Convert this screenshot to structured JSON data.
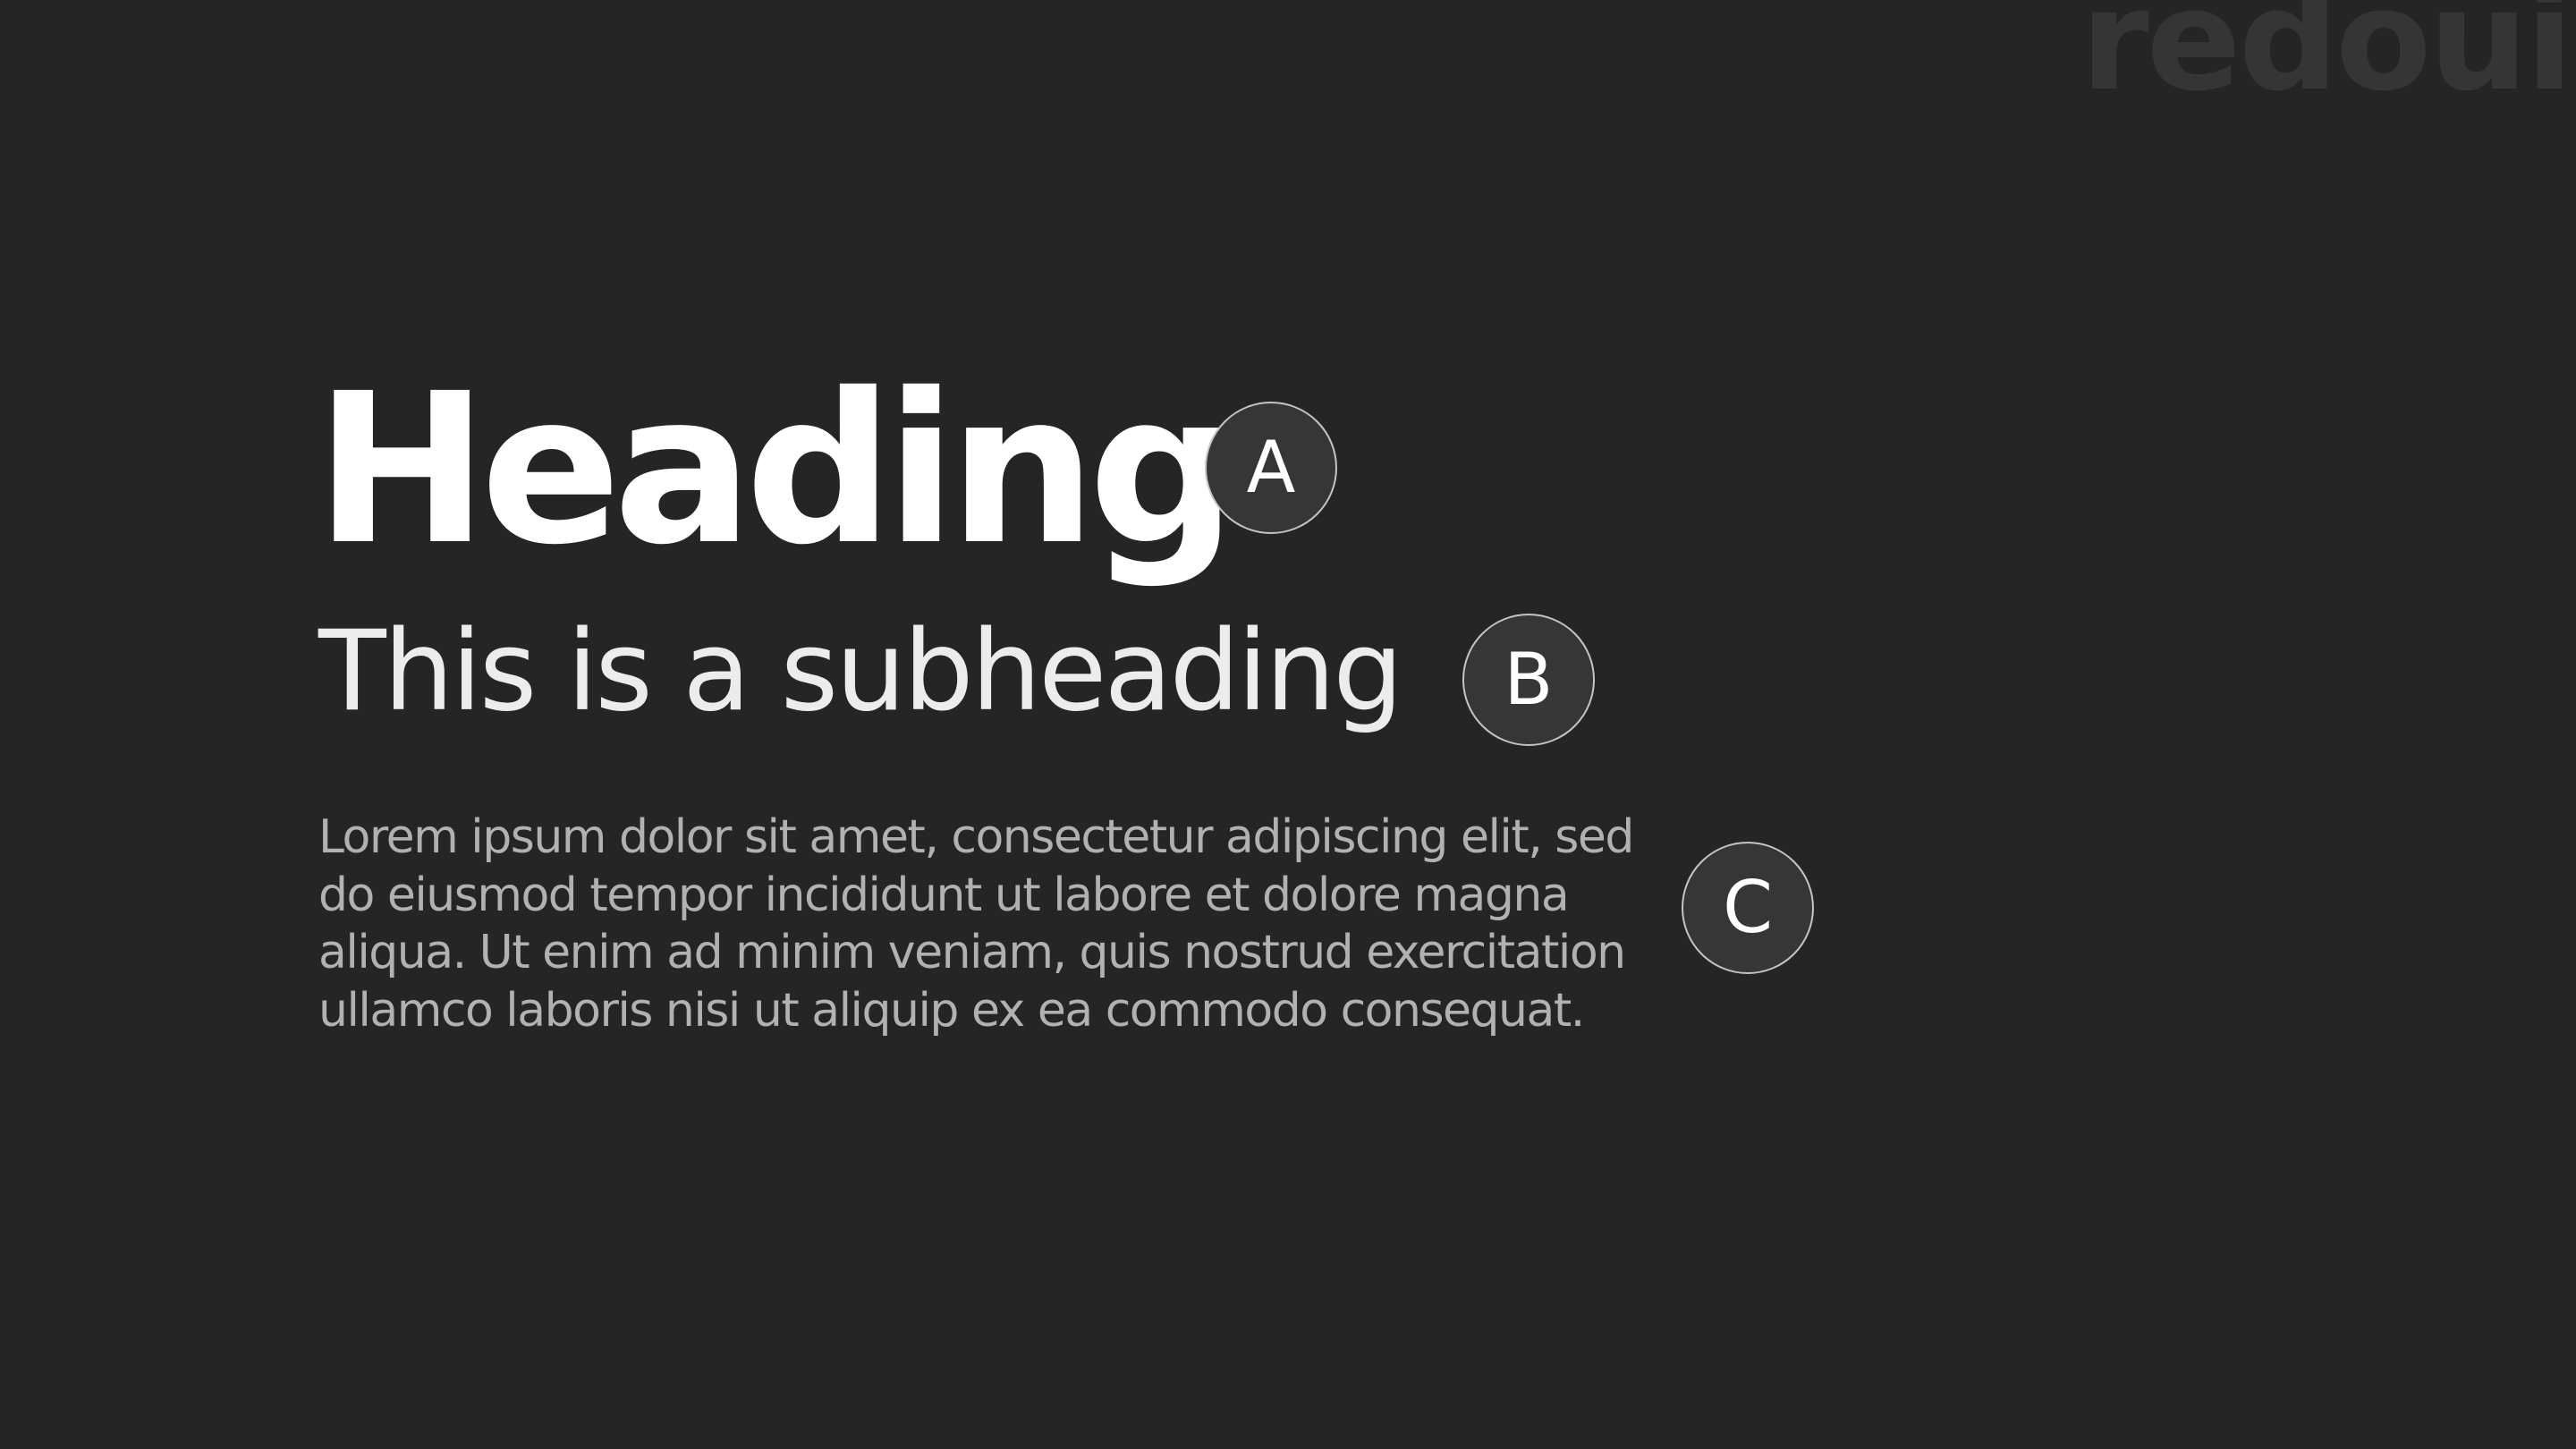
{
  "brand": {
    "logo_text": "redoui"
  },
  "typography": {
    "heading": "Heading",
    "subheading": "This is a subheading",
    "body": "Lorem ipsum dolor sit amet, consectetur adipiscing elit, sed do eiusmod tempor incididunt ut labore et dolore magna aliqua. Ut enim ad minim veniam, quis nostrud exercitation ullamco laboris nisi ut aliquip ex ea commodo consequat."
  },
  "markers": [
    {
      "label": "A"
    },
    {
      "label": "B"
    },
    {
      "label": "C"
    }
  ],
  "colors": {
    "background": "#252525",
    "heading": "#ffffff",
    "subheading": "#ececec",
    "body_text": "#b1b1b1",
    "badge_fill": "#363636",
    "badge_border": "#c4c4c4",
    "badge_text": "#ffffff",
    "logo": "#353535"
  }
}
